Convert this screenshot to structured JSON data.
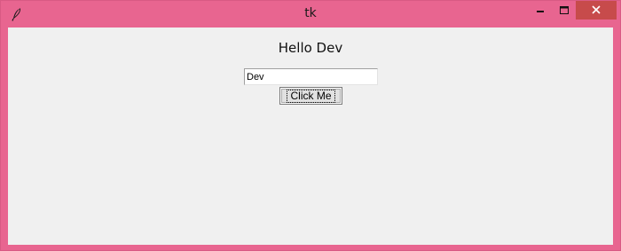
{
  "window": {
    "title": "tk",
    "accent_color": "#e86590",
    "app_icon": "feather-icon"
  },
  "controls": {
    "minimize_icon": "minimize-icon",
    "maximize_icon": "maximize-icon",
    "close_icon": "close-icon"
  },
  "main": {
    "greeting": "Hello Dev",
    "entry_value": "Dev",
    "button_label": "Click Me"
  }
}
